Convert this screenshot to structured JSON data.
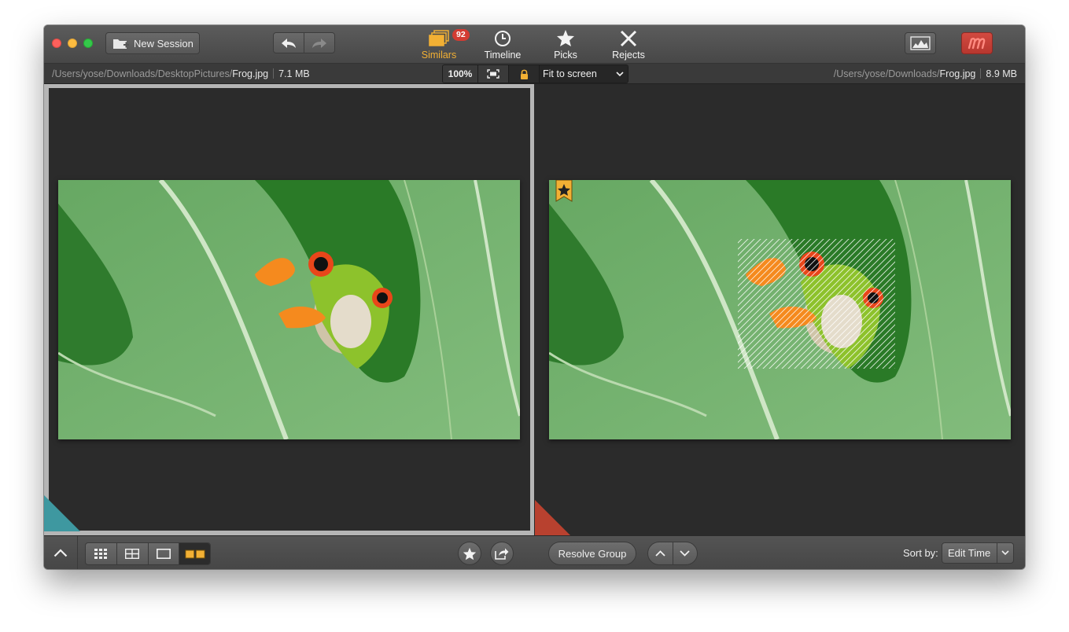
{
  "toolbar": {
    "new_session_label": "New Session",
    "modes": [
      {
        "label": "Similars",
        "icon": "stack-icon",
        "badge": "92",
        "active": true
      },
      {
        "label": "Timeline",
        "icon": "clock-icon"
      },
      {
        "label": "Picks",
        "icon": "star-icon"
      },
      {
        "label": "Rejects",
        "icon": "x-icon"
      }
    ],
    "accent_color": "#f2b034",
    "badge_color": "#d33b32",
    "brand_color": "#c43a32"
  },
  "left_image": {
    "path_prefix": "/Users/yose/Downloads/DesktopPictures/",
    "file_name": "Frog.jpg",
    "size": "7.1 MB",
    "corner_color": "#3e98a0"
  },
  "right_image": {
    "path_prefix": "/Users/yose/Downloads/",
    "file_name": "Frog.jpg",
    "size": "8.9 MB",
    "corner_color": "#b8412f",
    "picked": true
  },
  "zoom": {
    "percent": "100%",
    "fit_option": "Fit to screen"
  },
  "bottombar": {
    "resolve_label": "Resolve Group",
    "sort_label": "Sort by:",
    "sort_value": "Edit Time"
  }
}
